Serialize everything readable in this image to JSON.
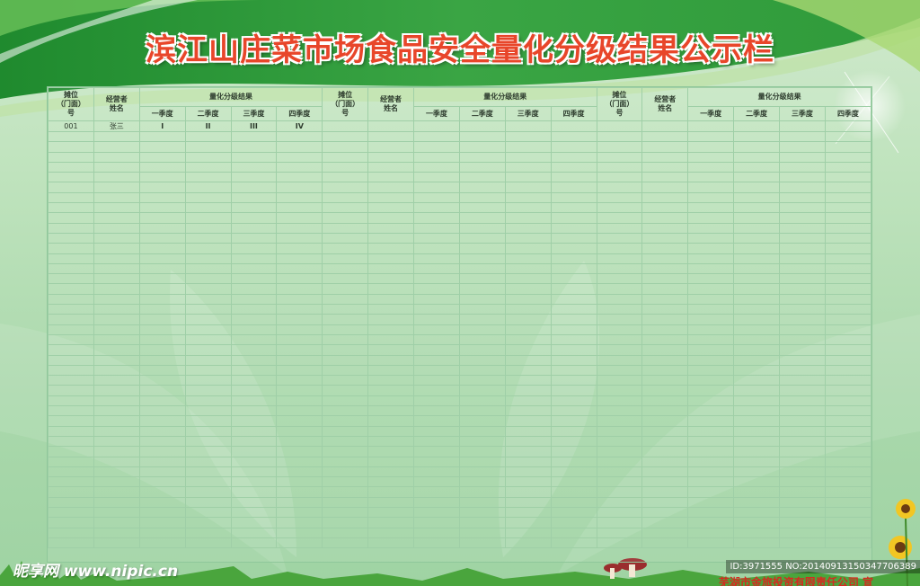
{
  "title": "滨江山庄菜市场食品安全量化分级结果公示栏",
  "table": {
    "stall_header": [
      "摊位",
      "（门面）",
      "号"
    ],
    "owner_header": [
      "经营者",
      "姓名"
    ],
    "grade_header": "量化分级结果",
    "quarters": [
      "一季度",
      "二季度",
      "三季度",
      "四季度"
    ],
    "row1": {
      "stall": "001",
      "owner": "张三",
      "grades": [
        "I",
        "II",
        "III",
        "IV"
      ]
    }
  },
  "watermark": {
    "site": "昵享网 www.nipic.cn",
    "id": "ID:3971555 NO:20140913150347706389"
  },
  "company_text": "芜湖市金旅投资有限责任公司 宣",
  "colors": {
    "title": "#e8462a",
    "band": "#2e9a3a",
    "grid_line": "#9fcfa7",
    "grade_text": "#d62a20"
  }
}
